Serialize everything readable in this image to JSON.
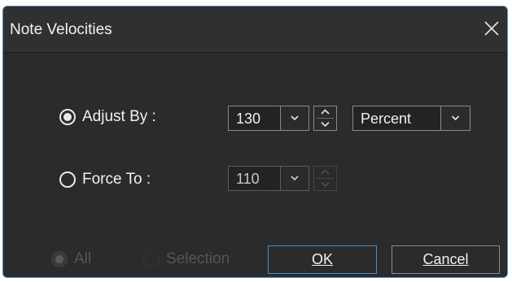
{
  "dialog": {
    "title": "Note Velocities"
  },
  "adjust_by": {
    "label": "Adjust By :",
    "selected": true,
    "value": "130",
    "unit": "Percent"
  },
  "force_to": {
    "label": "Force To :",
    "selected": false,
    "value": "110"
  },
  "scope": {
    "all_label": "All",
    "selection_label": "Selection",
    "all_selected": true
  },
  "buttons": {
    "ok": "OK",
    "cancel": "Cancel"
  },
  "colors": {
    "dialog_bg": "#2b2b2b",
    "accent": "#3f8fd4",
    "text": "#f0f0f0",
    "disabled_text": "#555555"
  },
  "icons": {
    "close": "close-icon",
    "dropdown": "chevron-down-icon",
    "spinner_up": "chevron-up-icon",
    "spinner_down": "chevron-down-icon"
  }
}
